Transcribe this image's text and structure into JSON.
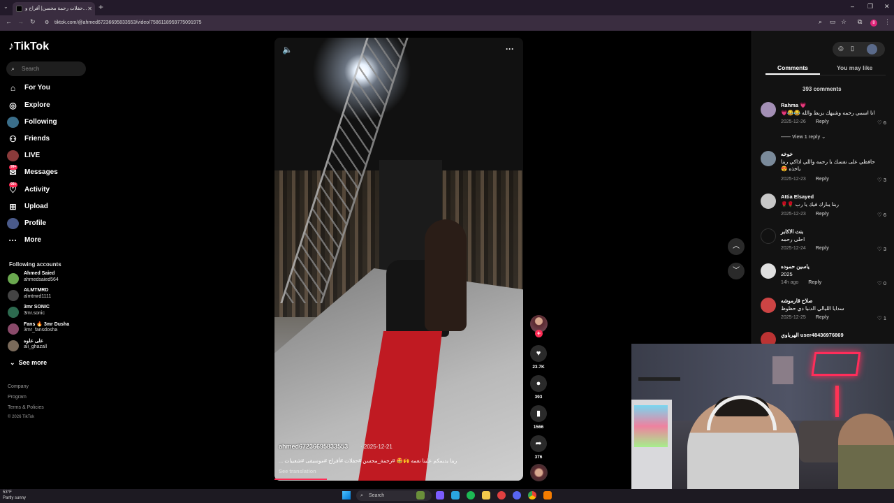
{
  "browser": {
    "tab_title": "حفلات رحمة محسن| أفراح و...",
    "url": "tiktok.com/@ahmed67236695833553/video/7586118959775091975",
    "profile_initial": "8"
  },
  "sidebar": {
    "logo": "TikTok",
    "search_placeholder": "Search",
    "nav": [
      {
        "label": "For You",
        "icon": "home-icon"
      },
      {
        "label": "Explore",
        "icon": "compass-icon"
      },
      {
        "label": "Following",
        "icon": "following-icon"
      },
      {
        "label": "Friends",
        "icon": "friends-icon"
      },
      {
        "label": "LIVE",
        "icon": "live-icon"
      },
      {
        "label": "Messages",
        "icon": "messages-icon",
        "badge": "99+"
      },
      {
        "label": "Activity",
        "icon": "activity-icon",
        "badge": "99+"
      },
      {
        "label": "Upload",
        "icon": "upload-icon"
      },
      {
        "label": "Profile",
        "icon": "profile-icon"
      },
      {
        "label": "More",
        "icon": "more-icon"
      }
    ],
    "following_title": "Following accounts",
    "accounts": [
      {
        "name": "Ahmed Saied",
        "handle": "ahmedsaied564"
      },
      {
        "name": "ALMTMRD",
        "handle": "almtmrd1111"
      },
      {
        "name": "3mr SONIC",
        "handle": "3mr.sonic"
      },
      {
        "name": "Fans 🔥 3mr Dusha",
        "handle": "3mr_fansdosha"
      },
      {
        "name": "على علوه",
        "handle": "ali_ghazall"
      }
    ],
    "see_more": "See more",
    "footer": [
      "Company",
      "Program",
      "Terms & Policies",
      "© 2026 TikTok"
    ]
  },
  "video": {
    "author": "ahmed67236695833553",
    "date": "· 2025-12-21",
    "caption": "ربنا يديمكم علينا نعمه 🙌🤩 #رحمة_محسن #حفلات #أفراح #موسيقى #شعبيات ...",
    "see_translation": "See translation",
    "progress": 0.21
  },
  "actions": {
    "likes": "23.7K",
    "comments": "393",
    "saves": "1566",
    "shares": "376"
  },
  "panel": {
    "tab_comments": "Comments",
    "tab_you_may_like": "You may like",
    "comment_count": "393 comments",
    "view_reply": "View 1 reply",
    "reply_label": "Reply",
    "comments": [
      {
        "user": "Rahma 💗",
        "text": "انا اسمي رحمه وشبهك بزبط والله 😂😂💗",
        "date": "2025-12-26",
        "likes": "6"
      },
      {
        "user": "خوخه",
        "text": "حافظي على نفسك يا رحمه واللي اذاكي ربنا ياخذه 😍",
        "date": "2025-12-23",
        "likes": "3"
      },
      {
        "user": "Attia Elsayed",
        "text": "ربنا يبارك فيك يا رب 🌹🌹",
        "date": "2025-12-23",
        "likes": "6"
      },
      {
        "user": "بنت الاكابر",
        "text": "احلى رحمه",
        "date": "2025-12-24",
        "likes": "3"
      },
      {
        "user": "ياسين حموده",
        "text": "2025",
        "date": "14h ago",
        "likes": "0"
      },
      {
        "user": "صلاح قارموشه",
        "text": "سدايا الليالي الدنيا دي حظوظ",
        "date": "2025-12-25",
        "likes": "1"
      },
      {
        "user": "الهرباوي user48436976869",
        "text": "",
        "date": "",
        "likes": ""
      }
    ]
  },
  "taskbar": {
    "temp": "53°F",
    "weather": "Partly sunny",
    "search": "Search"
  },
  "colors": {
    "accent": "#fe2c55",
    "background": "#000000",
    "panel": "#121212"
  }
}
